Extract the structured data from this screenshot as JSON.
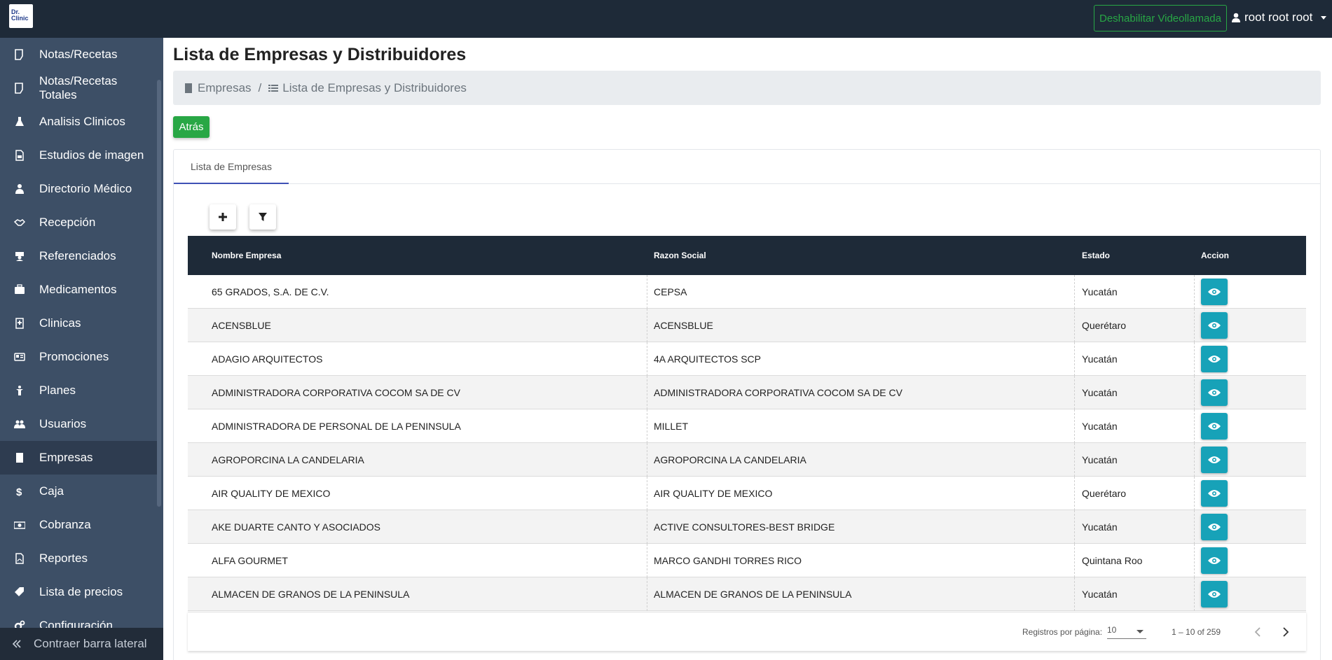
{
  "header": {
    "logo_text": "Dr. Clinic",
    "video_button": "Deshabilitar Videollamada",
    "user_name": "root root root"
  },
  "sidebar": {
    "items": [
      {
        "label": "Notas/Recetas",
        "icon": "note-icon"
      },
      {
        "label": "Notas/Recetas Totales",
        "icon": "note-icon"
      },
      {
        "label": "Analisis Clinicos",
        "icon": "flask-icon"
      },
      {
        "label": "Estudios de imagen",
        "icon": "image-file-icon"
      },
      {
        "label": "Directorio Médico",
        "icon": "doctor-icon"
      },
      {
        "label": "Recepción",
        "icon": "handshake-icon"
      },
      {
        "label": "Referenciados",
        "icon": "hospital-user-icon"
      },
      {
        "label": "Medicamentos",
        "icon": "medkit-icon"
      },
      {
        "label": "Clinicas",
        "icon": "clinic-icon"
      },
      {
        "label": "Promociones",
        "icon": "newspaper-icon"
      },
      {
        "label": "Planes",
        "icon": "child-icon"
      },
      {
        "label": "Usuarios",
        "icon": "users-icon"
      },
      {
        "label": "Empresas",
        "icon": "building-icon",
        "active": true
      },
      {
        "label": "Caja",
        "icon": "dollar-icon"
      },
      {
        "label": "Cobranza",
        "icon": "money-bill-icon"
      },
      {
        "label": "Reportes",
        "icon": "pdf-icon"
      },
      {
        "label": "Lista de precios",
        "icon": "tags-icon"
      },
      {
        "label": "Configuración",
        "icon": "cogs-icon"
      }
    ],
    "collapse_label": "Contraer barra lateral"
  },
  "page": {
    "title": "Lista de Empresas y Distribuidores",
    "breadcrumb": [
      "Empresas",
      "/",
      "Lista de Empresas y Distribuidores"
    ],
    "back_button": "Atrás",
    "tab": "Lista de Empresas"
  },
  "table": {
    "headers": [
      "Nombre Empresa",
      "Razon Social",
      "Estado",
      "Accion"
    ],
    "rows": [
      [
        "65 GRADOS, S.A. DE C.V.",
        "CEPSA",
        "Yucatán"
      ],
      [
        "ACENSBLUE",
        "ACENSBLUE",
        "Querétaro"
      ],
      [
        "ADAGIO ARQUITECTOS",
        "4A ARQUITECTOS SCP",
        "Yucatán"
      ],
      [
        "ADMINISTRADORA CORPORATIVA COCOM SA DE CV",
        "ADMINISTRADORA CORPORATIVA COCOM SA DE CV",
        "Yucatán"
      ],
      [
        "ADMINISTRADORA DE PERSONAL DE LA PENINSULA",
        "MILLET",
        "Yucatán"
      ],
      [
        "AGROPORCINA LA CANDELARIA",
        "AGROPORCINA LA CANDELARIA",
        "Yucatán"
      ],
      [
        "AIR QUALITY DE MEXICO",
        "AIR QUALITY DE MEXICO",
        "Querétaro"
      ],
      [
        "AKE DUARTE CANTO Y ASOCIADOS",
        "ACTIVE CONSULTORES-BEST BRIDGE",
        "Yucatán"
      ],
      [
        "ALFA GOURMET",
        "MARCO GANDHI TORRES RICO",
        "Quintana Roo"
      ],
      [
        "ALMACEN DE GRANOS DE LA PENINSULA",
        "ALMACEN DE GRANOS DE LA PENINSULA",
        "Yucatán"
      ]
    ]
  },
  "paginator": {
    "label": "Registros por página:",
    "page_size": "10",
    "range": "1 – 10 of 259"
  },
  "colors": {
    "topbar": "#1e2a38",
    "sidebar": "#3d4f66",
    "accent_green": "#28a745",
    "eye_button": "#17a2b8"
  }
}
